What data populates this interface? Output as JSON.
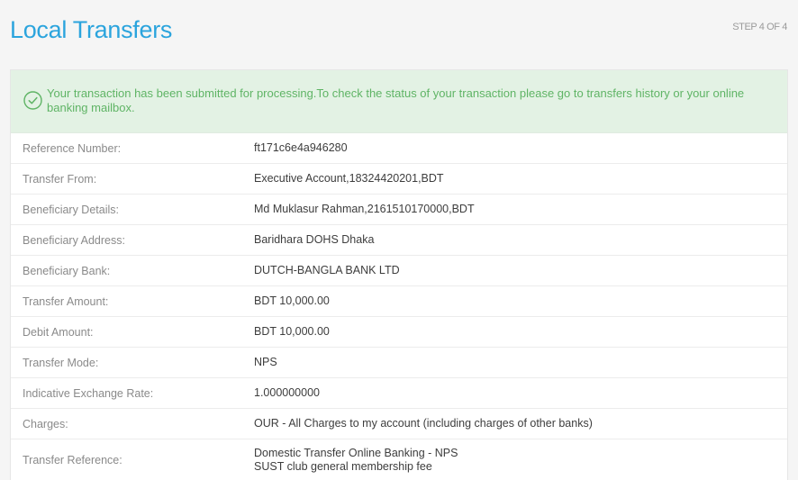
{
  "page": {
    "title": "Local Transfers",
    "step": "STEP 4 OF 4"
  },
  "alert": {
    "icon": "check-circle-icon",
    "color": "#5fb465",
    "message": "Your transaction has been submitted for processing.To check the status of your transaction please go to transfers history or your online banking mailbox."
  },
  "details": [
    {
      "label": "Reference Number:",
      "value": "ft171c6e4a946280"
    },
    {
      "label": "Transfer From:",
      "value": "Executive Account,18324420201,BDT"
    },
    {
      "label": "Beneficiary Details:",
      "value": "Md Muklasur Rahman,2161510170000,BDT"
    },
    {
      "label": "Beneficiary Address:",
      "value": "Baridhara DOHS Dhaka"
    },
    {
      "label": "Beneficiary Bank:",
      "value": "DUTCH-BANGLA BANK LTD"
    },
    {
      "label": "Transfer Amount:",
      "value": "BDT 10,000.00"
    },
    {
      "label": "Debit Amount:",
      "value": "BDT 10,000.00"
    },
    {
      "label": "Transfer Mode:",
      "value": "NPS"
    },
    {
      "label": "Indicative Exchange Rate:",
      "value": "1.000000000"
    },
    {
      "label": "Charges:",
      "value": "OUR - All Charges to my account (including charges of other banks)"
    },
    {
      "label": "Transfer Reference:",
      "value_line1": "Domestic Transfer Online Banking - NPS",
      "value_line2": "SUST club general membership fee"
    }
  ]
}
